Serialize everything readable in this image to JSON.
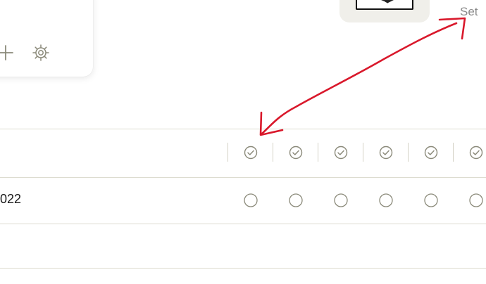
{
  "card": {
    "buttons": [
      {
        "name": "add-icon"
      },
      {
        "name": "gear-icon"
      }
    ]
  },
  "toolbar": {
    "set_label": "Set"
  },
  "table": {
    "header_icons": [
      "check-circle-icon",
      "check-circle-icon",
      "check-circle-icon",
      "check-circle-icon",
      "check-circle-icon",
      "check-circle-icon"
    ],
    "rows": [
      {
        "label": "022",
        "cells": [
          "empty",
          "empty",
          "empty",
          "empty",
          "empty",
          "empty"
        ]
      }
    ]
  },
  "annotation": {
    "color": "#d9182b",
    "type": "double-headed-arrow"
  },
  "colors": {
    "icon": "#8b8a7a",
    "divider": "#dddcd0",
    "card_bg": "#ffffff",
    "thumb_bg": "#f0efea"
  }
}
